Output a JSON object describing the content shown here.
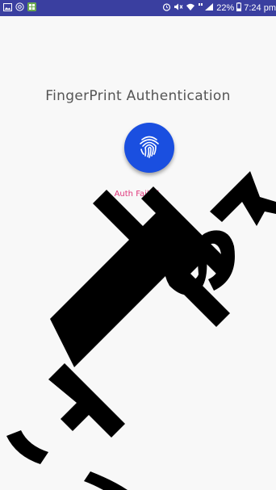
{
  "status_bar": {
    "left_icons": [
      "image-icon",
      "at-sign-icon",
      "app-notification-icon"
    ],
    "right_icons": [
      "alarm-icon",
      "mute-icon",
      "wifi-icon",
      "hd-signal-icon"
    ],
    "battery": "22%",
    "time": "7:24 pm",
    "background_color": "#3a3fa0"
  },
  "main": {
    "title": "FingerPrint Authentication",
    "fingerprint_button_color": "#1a4fe0",
    "fingerprint_icon": "fingerprint-icon",
    "status_message": "Auth Failed.",
    "status_color": "#e0357a"
  },
  "overlay": {
    "watermark": "watermark-logo"
  }
}
